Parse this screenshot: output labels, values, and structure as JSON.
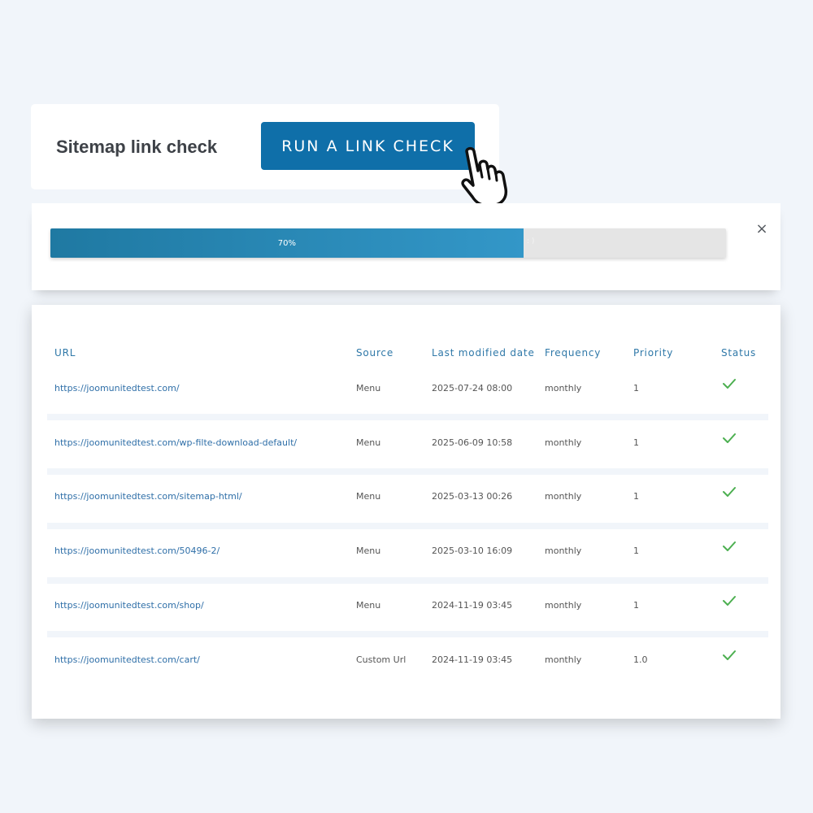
{
  "header": {
    "title": "Sitemap link check",
    "run_button_label": "RUN A LINK CHECK"
  },
  "progress": {
    "percent": 70,
    "label": "70%",
    "trailing_text": ": )",
    "close_label": "×"
  },
  "table": {
    "columns": {
      "url": "URL",
      "source": "Source",
      "last_modified": "Last modified date",
      "frequency": "Frequency",
      "priority": "Priority",
      "status": "Status"
    },
    "rows": [
      {
        "url": "https://joomunitedtest.com/",
        "source": "Menu",
        "date": "2025-07-24 08:00",
        "frequency": "monthly",
        "priority": "1",
        "status": "ok"
      },
      {
        "url": "https://joomunitedtest.com/wp-filte-download-default/",
        "source": "Menu",
        "date": "2025-06-09 10:58",
        "frequency": "monthly",
        "priority": "1",
        "status": "ok"
      },
      {
        "url": "https://joomunitedtest.com/sitemap-html/",
        "source": "Menu",
        "date": "2025-03-13 00:26",
        "frequency": "monthly",
        "priority": "1",
        "status": "ok"
      },
      {
        "url": "https://joomunitedtest.com/50496-2/",
        "source": "Menu",
        "date": "2025-03-10 16:09",
        "frequency": "monthly",
        "priority": "1",
        "status": "ok"
      },
      {
        "url": "https://joomunitedtest.com/shop/",
        "source": "Menu",
        "date": "2024-11-19 03:45",
        "frequency": "monthly",
        "priority": "1",
        "status": "ok"
      },
      {
        "url": "https://joomunitedtest.com/cart/",
        "source": "Custom Url",
        "date": "2024-11-19 03:45",
        "frequency": "monthly",
        "priority": "1.0",
        "status": "ok"
      }
    ]
  },
  "colors": {
    "background": "#f1f5fa",
    "button": "#0f6fa9",
    "progress_start": "#1f79a2",
    "progress_end": "#3397c8",
    "link": "#2f6fa8",
    "header_text": "#2f78a8",
    "check": "#4caf50"
  },
  "icons": {
    "cursor": "hand-pointer-icon",
    "close": "close-icon",
    "status_ok": "checkmark-icon"
  }
}
